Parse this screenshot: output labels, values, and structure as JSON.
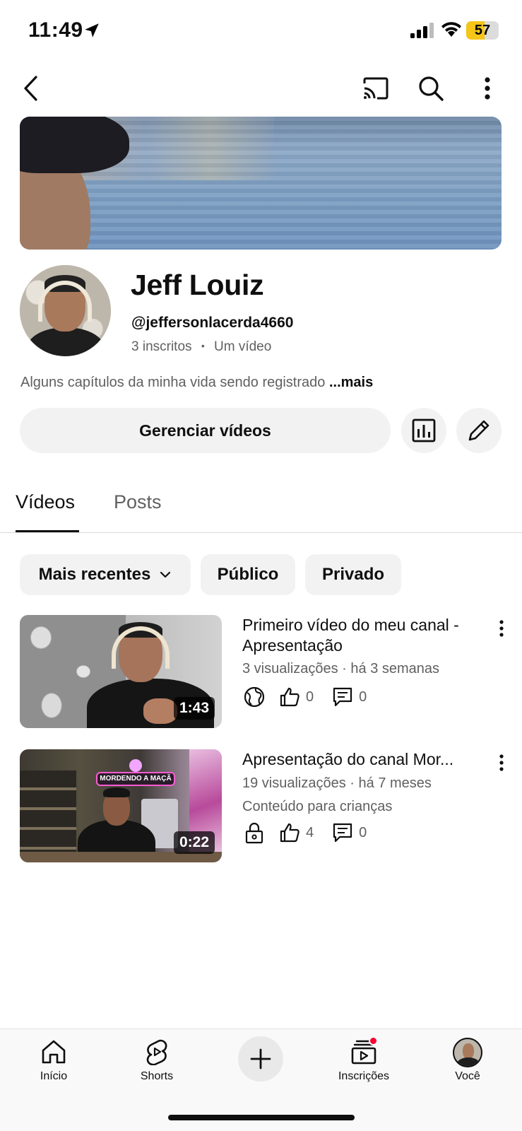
{
  "status_bar": {
    "time": "11:49",
    "battery_percent": "57",
    "battery_color": "#f5c518"
  },
  "top_nav": {
    "icons": [
      "back-icon",
      "cast-icon",
      "search-icon",
      "more-vert-icon"
    ]
  },
  "channel": {
    "name": "Jeff Louiz",
    "handle": "@jeffersonlacerda4660",
    "subscribers": "3 inscritos",
    "separator": "•",
    "video_count": "Um vídeo",
    "description": "Alguns capítulos da minha vida sendo registrado",
    "description_more": "...mais",
    "manage_button": "Gerenciar vídeos"
  },
  "tabs": [
    {
      "label": "Vídeos",
      "active": true
    },
    {
      "label": "Posts",
      "active": false
    }
  ],
  "filters": {
    "sort": "Mais recentes",
    "public": "Público",
    "private": "Privado"
  },
  "videos": [
    {
      "title": "Primeiro vídeo do meu canal - Apresentação",
      "meta": "3 visualizações · há 3 semanas",
      "extra": "",
      "duration": "1:43",
      "visibility_icon": "globe-icon",
      "likes": "0",
      "comments": "0"
    },
    {
      "title": "Apresentação do canal Mor...",
      "meta": "19 visualizações · há 7 meses",
      "extra": "Conteúdo para crianças",
      "duration": "0:22",
      "thumb_sign": "MORDENDO A MAÇÃ",
      "visibility_icon": "lock-icon",
      "likes": "4",
      "comments": "0"
    }
  ],
  "bottom_nav": {
    "home": "Início",
    "shorts": "Shorts",
    "subscriptions": "Inscrições",
    "you": "Você"
  },
  "colors": {
    "accent_red": "#ff0033",
    "chip_bg": "#f2f2f2",
    "secondary_text": "#606060"
  }
}
